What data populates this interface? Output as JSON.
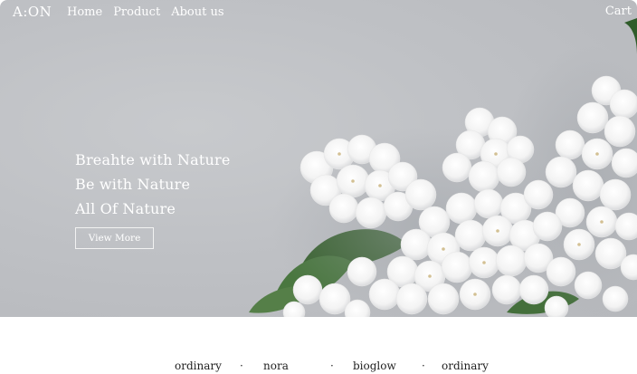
{
  "header": {
    "logo": "A:ON",
    "nav": [
      "Home",
      "Product",
      "About us"
    ],
    "cart": "Cart"
  },
  "hero": {
    "lines": [
      "Breahte with Nature",
      "Be with Nature",
      "All Of Nature"
    ],
    "cta": "View More",
    "background_color": "#bfc1c5",
    "image_subject": "white lilac flowers"
  },
  "brands": {
    "items": [
      "ordinary",
      "nora",
      "bioglow",
      "ordinary"
    ],
    "separator": "·"
  },
  "colors": {
    "text_light": "#ffffff",
    "text_dark": "#222222",
    "leaf": "#3f6a34"
  }
}
